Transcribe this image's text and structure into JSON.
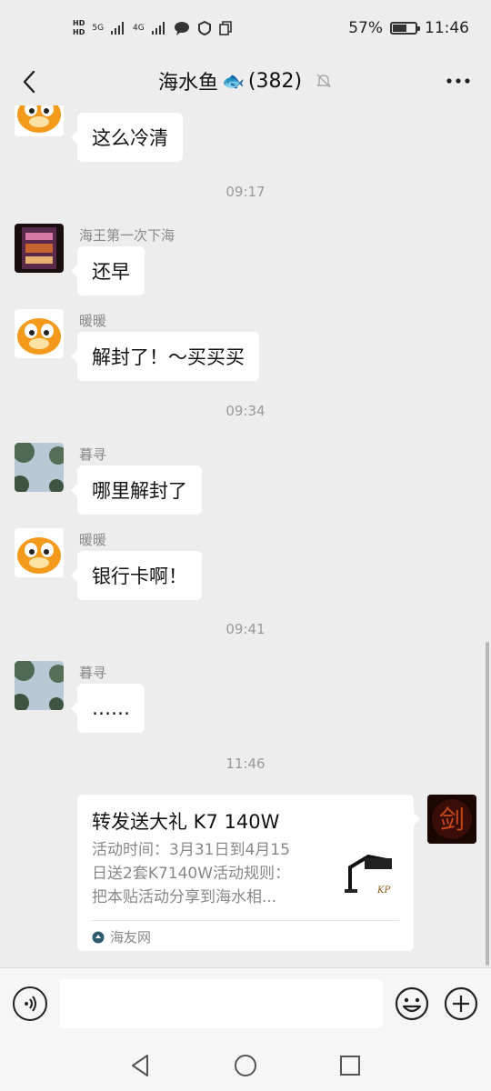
{
  "status_bar": {
    "hd1": "HD",
    "hd2": "HD",
    "net1": "5G",
    "net2": "4G",
    "battery_pct": "57%",
    "battery_level": 0.57,
    "time": "11:46"
  },
  "header": {
    "title": "海水鱼",
    "fish": "🐟",
    "count": "(382)"
  },
  "messages": {
    "m0_text": "这么冷清",
    "t1": "09:17",
    "m1_sender": "海王第一次下海",
    "m1_text": "还早",
    "m2_sender": "暖暖",
    "m2_text": "解封了！～买买买",
    "t2": "09:34",
    "m3_sender": "暮寻",
    "m3_text": "哪里解封了",
    "m4_sender": "暖暖",
    "m4_text": "银行卡啊！",
    "t3": "09:41",
    "m5_sender": "暮寻",
    "m5_text": "……",
    "t4": "11:46"
  },
  "card": {
    "title": "转发送大礼 K7 140W",
    "desc_line1": "活动时间：3月31日到4月15",
    "desc_line2": "日送2套K7140W活动规则：",
    "desc_line3": "把本贴活动分享到海水相...",
    "source": "海友网",
    "thumb_label": "KP"
  },
  "self_avatar_char": "剑",
  "input": {
    "placeholder": ""
  },
  "colors": {
    "background": "#ededed",
    "bubble": "#ffffff",
    "text": "#111111",
    "muted": "#888888"
  },
  "icons": [
    "back-arrow-icon",
    "bell-muted-icon",
    "more-icon",
    "voice-icon",
    "emoji-icon",
    "plus-icon",
    "nav-back-icon",
    "nav-home-icon",
    "nav-recent-icon"
  ]
}
